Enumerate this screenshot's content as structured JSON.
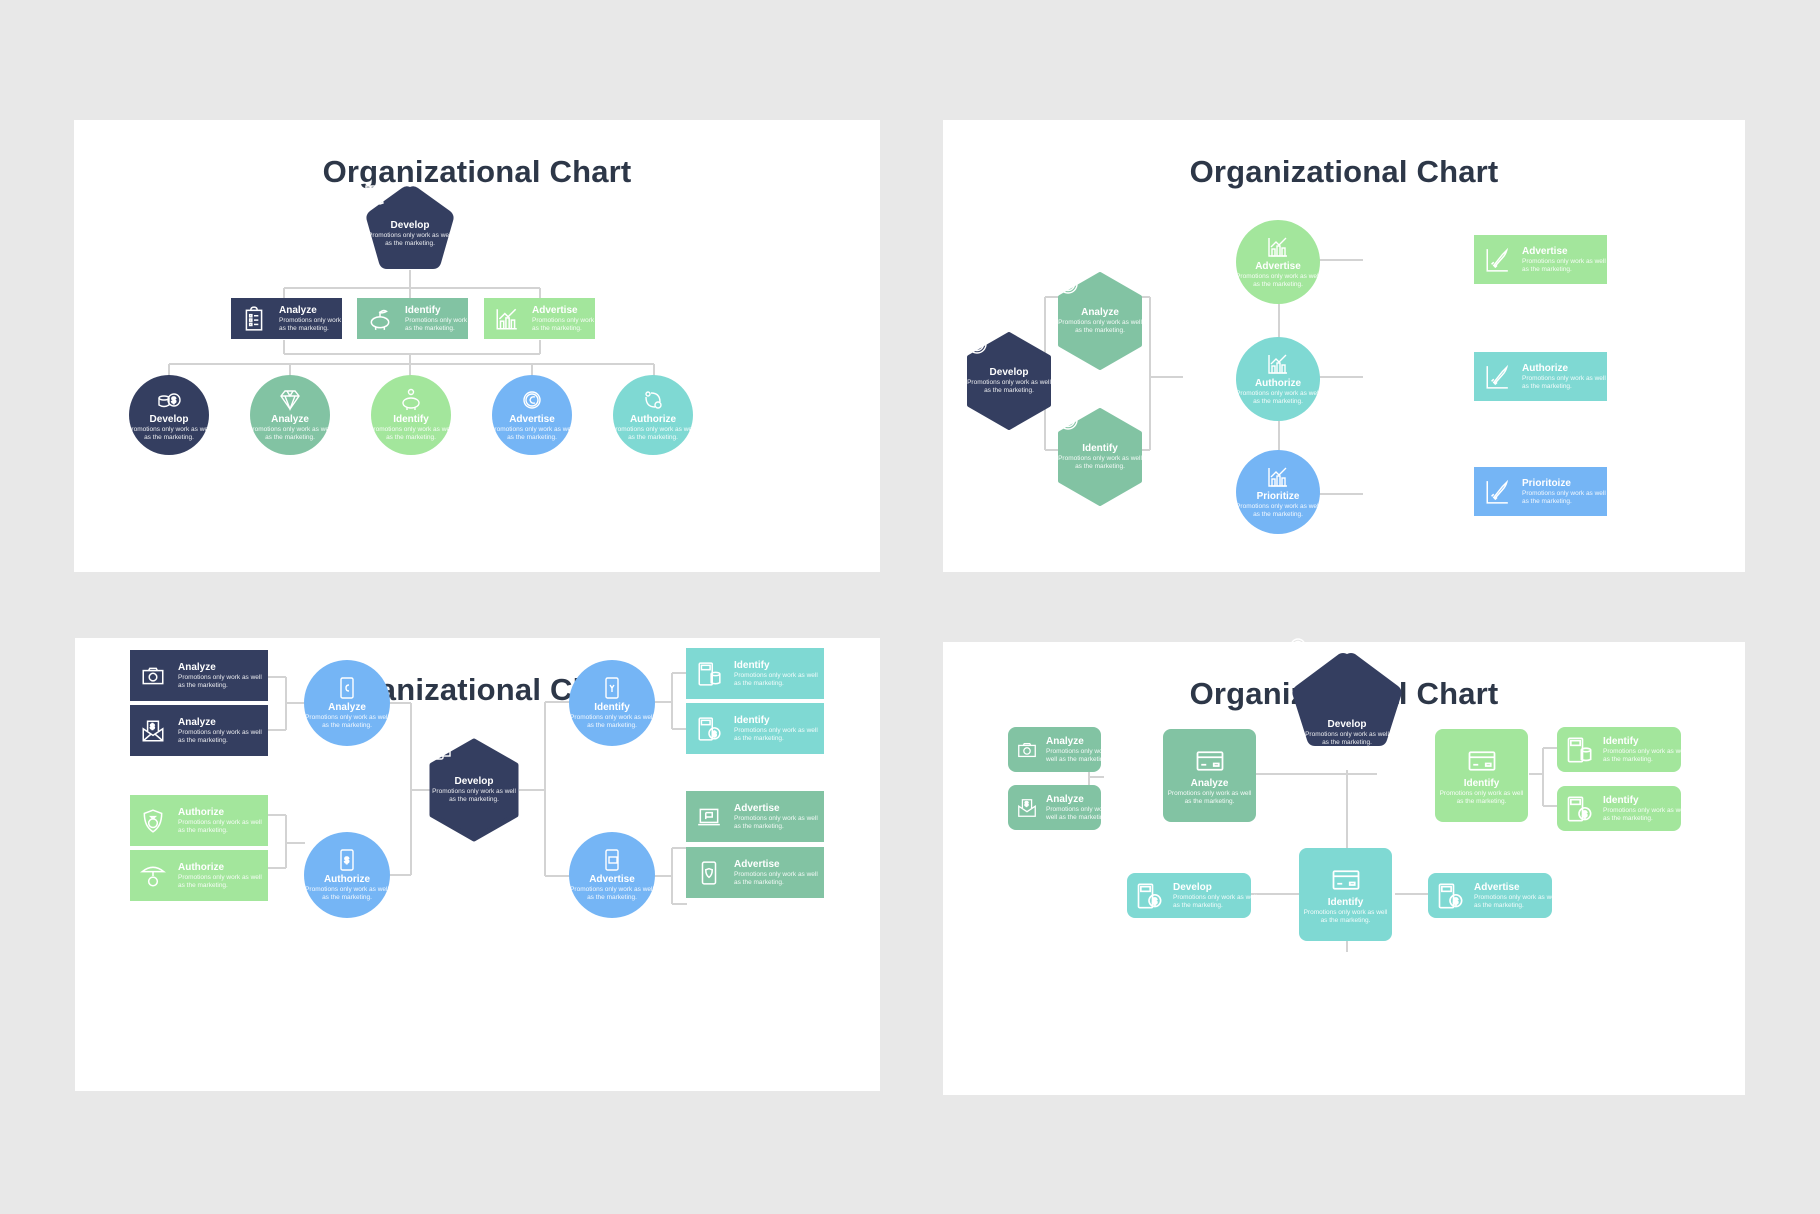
{
  "colors": {
    "navy": "#343e60",
    "sage": "#82c3a3",
    "lightgreen": "#a3e69c",
    "blue": "#75b5f5",
    "teal": "#7fd9d3",
    "connector": "#d3d3d3",
    "background": "#e8e8e8",
    "panel": "#ffffff",
    "title": "#2d3748"
  },
  "description_text": "Promotions only work as well as the marketing.",
  "slides": [
    {
      "title": "Organizational Chart",
      "root": {
        "label": "Develop",
        "icon": "binders-icon",
        "shape": "pentagon",
        "color": "navy"
      },
      "level2": [
        {
          "label": "Analyze",
          "icon": "clipboard-checklist-icon",
          "color": "navy"
        },
        {
          "label": "Identify",
          "icon": "piggy-bank-plant-icon",
          "color": "sage"
        },
        {
          "label": "Advertise",
          "icon": "bar-chart-growth-icon",
          "color": "lightgreen"
        }
      ],
      "level3": [
        {
          "label": "Develop",
          "icon": "coins-dollar-icon",
          "color": "navy"
        },
        {
          "label": "Analyze",
          "icon": "diamond-icon",
          "color": "sage"
        },
        {
          "label": "Identify",
          "icon": "piggy-bank-coin-icon",
          "color": "lightgreen"
        },
        {
          "label": "Advertise",
          "icon": "euro-coin-icon",
          "color": "blue"
        },
        {
          "label": "Authorize",
          "icon": "cycle-coins-icon",
          "color": "teal"
        }
      ]
    },
    {
      "title": "Organizational Chart",
      "root": {
        "label": "Develop",
        "icon": "dollar-coin-icon",
        "shape": "hexagon",
        "color": "navy"
      },
      "hexes": [
        {
          "label": "Analyze",
          "icon": "dollar-coin-icon",
          "color": "sage"
        },
        {
          "label": "Identify",
          "icon": "dollar-coin-icon",
          "color": "sage"
        }
      ],
      "circles": [
        {
          "label": "Advertise",
          "icon": "bar-chart-growth-icon",
          "color": "lightgreen"
        },
        {
          "label": "Authorize",
          "icon": "bar-chart-growth-icon",
          "color": "teal"
        },
        {
          "label": "Prioritize",
          "icon": "bar-chart-growth-icon",
          "color": "blue"
        }
      ],
      "boxes": [
        {
          "label": "Advertise",
          "icon": "rocket-chart-icon",
          "color": "lightgreen"
        },
        {
          "label": "Authorize",
          "icon": "rocket-chart-icon",
          "color": "teal"
        },
        {
          "label": "Prioritoize",
          "icon": "rocket-chart-icon",
          "color": "blue"
        }
      ]
    },
    {
      "title": "Organizational Chart",
      "root": {
        "label": "Develop",
        "icon": "phone-card-icon",
        "shape": "hexagon",
        "color": "navy"
      },
      "left_circles": [
        {
          "label": "Analyze",
          "icon": "phone-euro-icon",
          "color": "blue"
        },
        {
          "label": "Authorize",
          "icon": "phone-dollar-icon",
          "color": "blue"
        }
      ],
      "right_circles": [
        {
          "label": "Identify",
          "icon": "phone-yen-icon",
          "color": "blue"
        },
        {
          "label": "Advertise",
          "icon": "phone-atm-icon",
          "color": "blue"
        }
      ],
      "left_boxes": [
        {
          "label": "Analyze",
          "icon": "cash-bill-icon",
          "color": "navy"
        },
        {
          "label": "Analyze",
          "icon": "envelope-dollar-icon",
          "color": "navy"
        },
        {
          "label": "Authorize",
          "icon": "shield-moneybag-icon",
          "color": "lightgreen"
        },
        {
          "label": "Authorize",
          "icon": "umbrella-moneybag-icon",
          "color": "lightgreen"
        }
      ],
      "right_boxes": [
        {
          "label": "Identify",
          "icon": "calculator-coins-icon",
          "color": "teal"
        },
        {
          "label": "Identify",
          "icon": "calculator-dollar-icon",
          "color": "teal"
        },
        {
          "label": "Advertise",
          "icon": "laptop-flag-icon",
          "color": "sage"
        },
        {
          "label": "Advertise",
          "icon": "phone-shield-icon",
          "color": "sage"
        }
      ]
    },
    {
      "title": "Organizational Chart",
      "root": {
        "label": "Develop",
        "icon": "magnifier-dollar-icon",
        "shape": "pentagon",
        "color": "navy"
      },
      "hubs": [
        {
          "label": "Analyze",
          "icon": "credit-card-icon",
          "color": "sage"
        },
        {
          "label": "Identify",
          "icon": "credit-card-icon",
          "color": "lightgreen"
        },
        {
          "label": "Identify",
          "icon": "credit-card-icon",
          "color": "teal"
        }
      ],
      "left_boxes": [
        {
          "label": "Analyze",
          "icon": "cash-bill-icon",
          "color": "sage"
        },
        {
          "label": "Analyze",
          "icon": "envelope-dollar-icon",
          "color": "sage"
        }
      ],
      "right_boxes": [
        {
          "label": "Identify",
          "icon": "calculator-coins-icon",
          "color": "lightgreen"
        },
        {
          "label": "Identify",
          "icon": "calculator-dollar-icon",
          "color": "lightgreen"
        }
      ],
      "bottom_boxes": [
        {
          "label": "Develop",
          "icon": "calculator-dollar-icon",
          "color": "teal"
        },
        {
          "label": "Advertise",
          "icon": "calculator-dollar-icon",
          "color": "teal"
        }
      ]
    }
  ]
}
